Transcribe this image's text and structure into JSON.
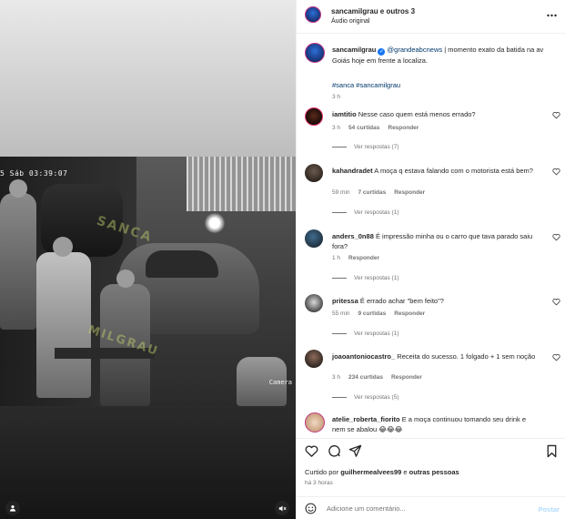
{
  "header": {
    "title": "sancamilgrau e outros 3",
    "subtitle": "Áudio original",
    "more_icon": "more-horizontal-icon"
  },
  "media": {
    "timestamp": "5 Sáb 03:39:07",
    "camera_label": "Camera",
    "watermark_1": "SANCA",
    "watermark_2": "MILGRAU",
    "user_icon": "user-tag-icon",
    "sound_icon": "muted-speaker-icon"
  },
  "caption": {
    "username": "sancamilgrau",
    "mention": "@grandeabcnews",
    "text": " | momento exato da batida na av Goiás hoje em frente a localiza.",
    "hashtags": "#sanca #sancamilgrau",
    "time": "3 h"
  },
  "comments": [
    {
      "username": "iamtitio",
      "text": "Nesse caso quem está menos errado?",
      "time": "3 h",
      "likes": "54 curtidas",
      "reply": "Responder",
      "replies": "Ver respostas (7)"
    },
    {
      "username": "kahandradet",
      "text": "A moça q estava falando com o motorista está bem?",
      "time": "59 min",
      "likes": "7 curtidas",
      "reply": "Responder",
      "replies": "Ver respostas (1)"
    },
    {
      "username": "anders_0n88",
      "text": "É impressão minha ou o carro que tava parado saiu fora?",
      "time": "1 h",
      "likes": "",
      "reply": "Responder",
      "replies": "Ver respostas (1)"
    },
    {
      "username": "pritessa",
      "text": "É errado achar \"bem feito\"?",
      "time": "55 min",
      "likes": "9 curtidas",
      "reply": "Responder",
      "replies": "Ver respostas (1)"
    },
    {
      "username": "joaoantoniocastro_",
      "text": "Receita do sucesso. 1 folgado + 1 sem noção",
      "time": "3 h",
      "likes": "234 curtidas",
      "reply": "Responder",
      "replies": "Ver respostas (5)"
    },
    {
      "username": "atelie_roberta_fiorito",
      "text": "E a moça continuou tomando seu drink e nem se abalou 😂😂😂",
      "time": "",
      "likes": "",
      "reply": "",
      "replies": ""
    }
  ],
  "footer": {
    "liked_prefix": "Curtido por ",
    "liked_user": "guilhermealvees99",
    "liked_middle": " e ",
    "liked_others": "outras pessoas",
    "ago": "há 3 horas",
    "comment_placeholder": "Adicione um comentário...",
    "post_label": "Postar"
  },
  "colors": {
    "accent_link": "#00376b",
    "verified": "#1877f2",
    "post_disabled": "#b3dbff",
    "secondary_text": "#737373"
  }
}
